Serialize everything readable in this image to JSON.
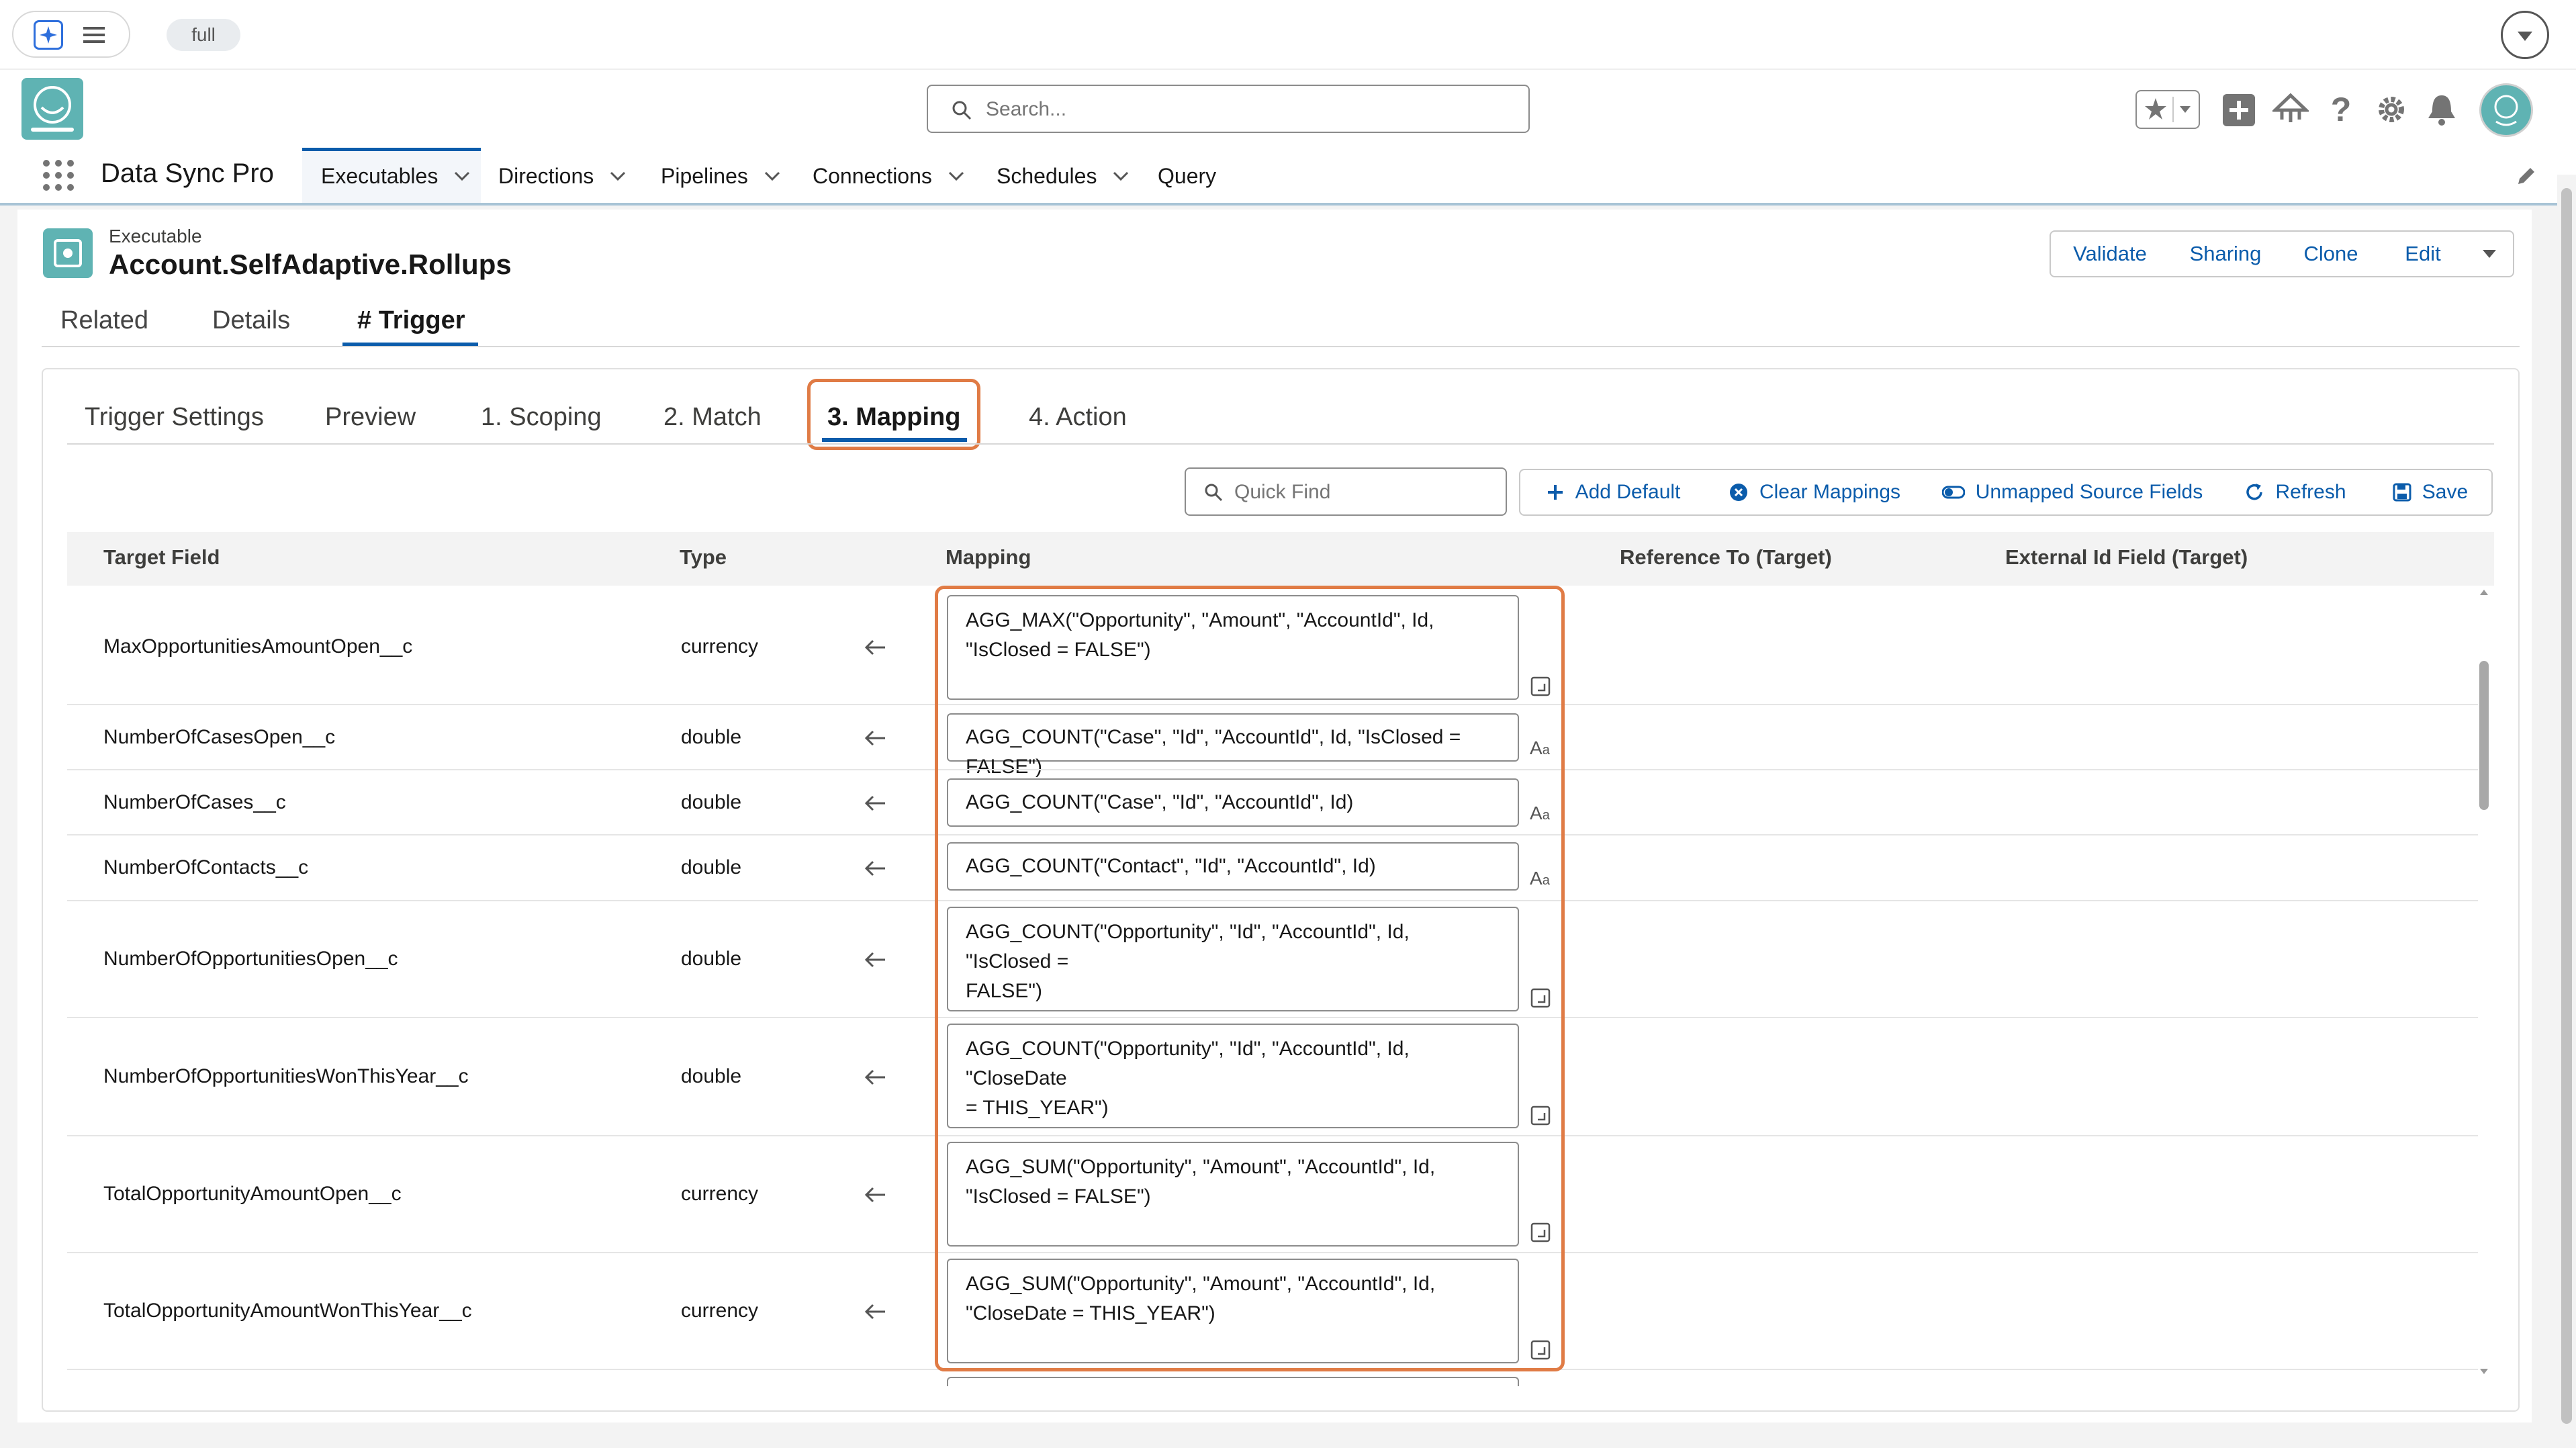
{
  "topbar": {
    "org_label": "full"
  },
  "header": {
    "search_placeholder": "Search..."
  },
  "nav": {
    "app_name": "Data Sync Pro",
    "tabs": [
      {
        "label": "Executables",
        "has_menu": true,
        "active": true
      },
      {
        "label": "Directions",
        "has_menu": true
      },
      {
        "label": "Pipelines",
        "has_menu": true
      },
      {
        "label": "Connections",
        "has_menu": true
      },
      {
        "label": "Schedules",
        "has_menu": true
      },
      {
        "label": "Query",
        "has_menu": false
      }
    ]
  },
  "record": {
    "object_label": "Executable",
    "title": "Account.SelfAdaptive.Rollups",
    "actions": [
      "Validate",
      "Sharing",
      "Clone",
      "Edit"
    ]
  },
  "record_tabs": [
    "Related",
    "Details",
    "# Trigger"
  ],
  "trigger_tabs": [
    "Trigger Settings",
    "Preview",
    "1. Scoping",
    "2. Match",
    "3. Mapping",
    "4. Action"
  ],
  "toolbar": {
    "quick_find_placeholder": "Quick Find",
    "add_default": "Add Default",
    "clear_mappings": "Clear Mappings",
    "unmapped_source_fields": "Unmapped Source Fields",
    "refresh": "Refresh",
    "save": "Save"
  },
  "table": {
    "columns": [
      "Target Field",
      "Type",
      "Mapping",
      "Reference To (Target)",
      "External Id Field (Target)"
    ],
    "rows": [
      {
        "field": "MaxOpportunitiesAmountOpen__c",
        "type": "currency",
        "mapping": "AGG_MAX(\"Opportunity\", \"Amount\", \"AccountId\", Id,\n\"IsClosed = FALSE\")"
      },
      {
        "field": "NumberOfCasesOpen__c",
        "type": "double",
        "mapping": "AGG_COUNT(\"Case\", \"Id\", \"AccountId\", Id, \"IsClosed = FALSE\")"
      },
      {
        "field": "NumberOfCases__c",
        "type": "double",
        "mapping": "AGG_COUNT(\"Case\", \"Id\", \"AccountId\", Id)"
      },
      {
        "field": "NumberOfContacts__c",
        "type": "double",
        "mapping": "AGG_COUNT(\"Contact\", \"Id\", \"AccountId\", Id)"
      },
      {
        "field": "NumberOfOpportunitiesOpen__c",
        "type": "double",
        "mapping": "AGG_COUNT(\"Opportunity\", \"Id\", \"AccountId\", Id, \"IsClosed =\nFALSE\")"
      },
      {
        "field": "NumberOfOpportunitiesWonThisYear__c",
        "type": "double",
        "mapping": "AGG_COUNT(\"Opportunity\", \"Id\", \"AccountId\", Id, \"CloseDate\n= THIS_YEAR\")"
      },
      {
        "field": "TotalOpportunityAmountOpen__c",
        "type": "currency",
        "mapping": "AGG_SUM(\"Opportunity\", \"Amount\", \"AccountId\", Id,\n\"IsClosed = FALSE\")"
      },
      {
        "field": "TotalOpportunityAmountWonThisYear__c",
        "type": "currency",
        "mapping": "AGG_SUM(\"Opportunity\", \"Amount\", \"AccountId\", Id,\n\"CloseDate = THIS_YEAR\")"
      }
    ]
  },
  "colors": {
    "brand_blue": "#0b5cab",
    "highlight_orange": "#e07b45",
    "logo_teal": "#5fb3b3"
  }
}
